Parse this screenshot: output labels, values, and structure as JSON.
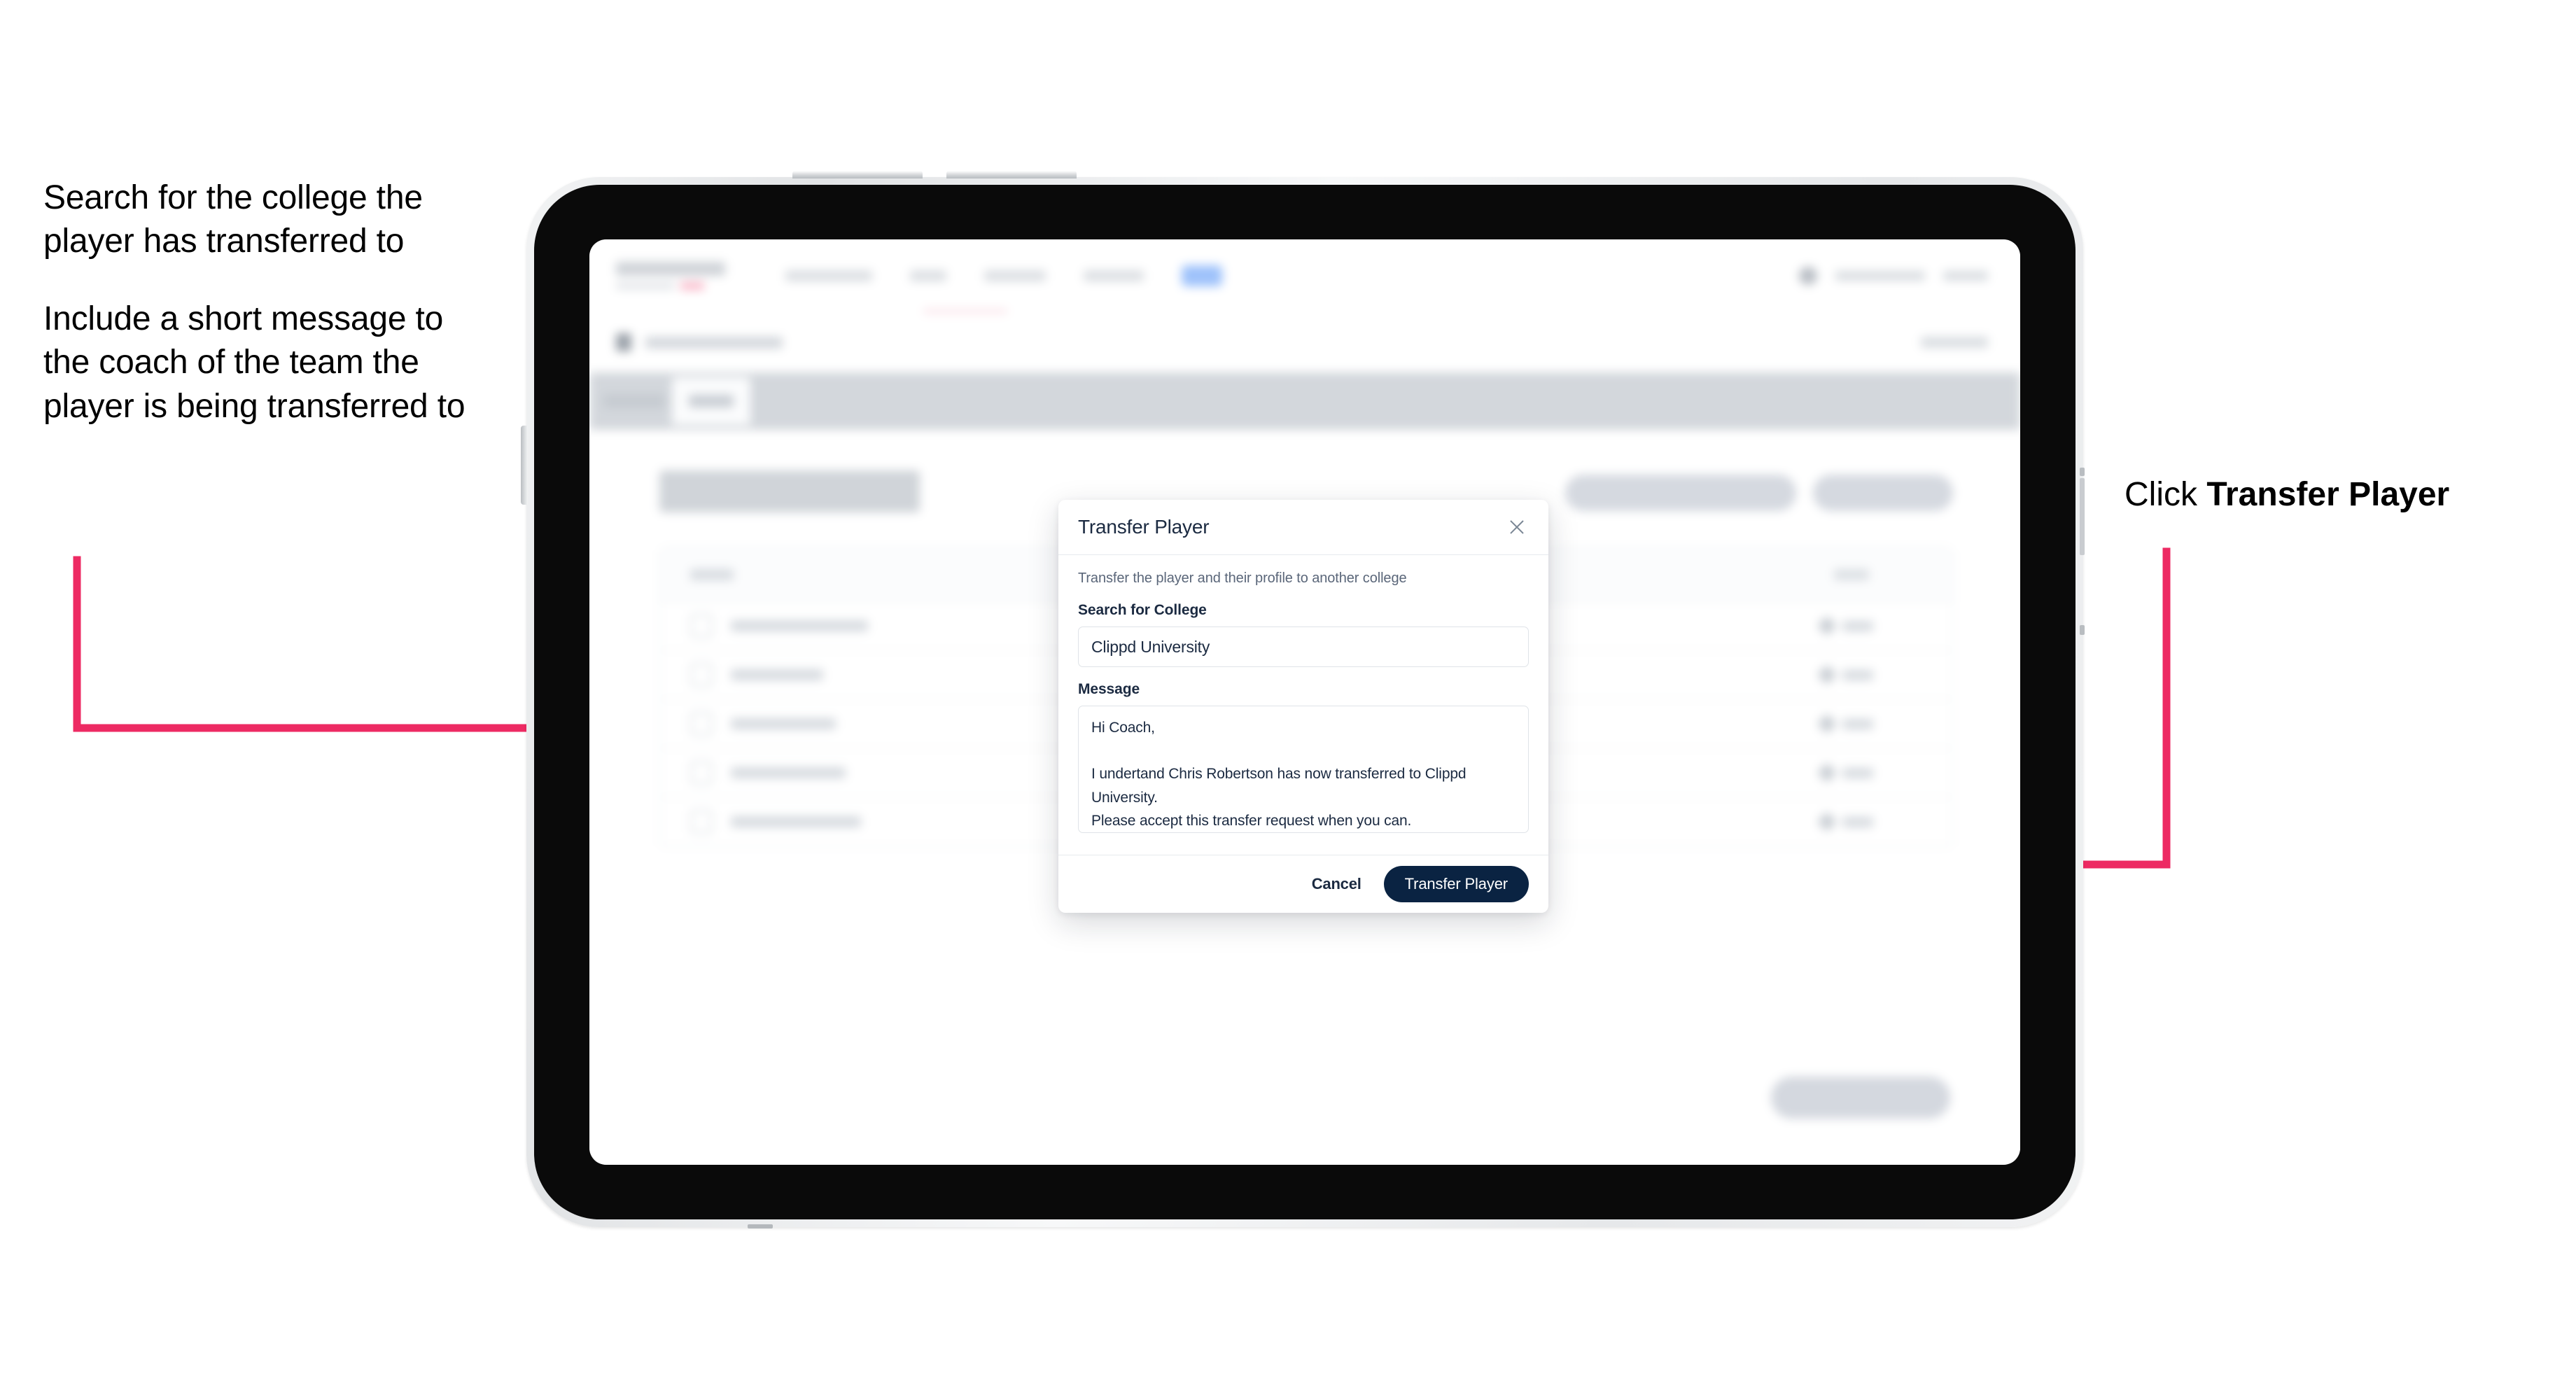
{
  "annotations": {
    "left": [
      "Search for the college the player has transferred to",
      "Include a short message to the coach of the team the player is being transferred to"
    ],
    "right_prefix": "Click ",
    "right_bold": "Transfer Player"
  },
  "modal": {
    "title": "Transfer Player",
    "close_icon": "close-icon",
    "subtitle": "Transfer the player and their profile to another college",
    "college_label": "Search for College",
    "college_value": "Clippd University",
    "college_placeholder": "Search for College",
    "message_label": "Message",
    "message_value": "Hi Coach,\n\nI undertand Chris Robertson has now transferred to Clippd University.\nPlease accept this transfer request when you can.",
    "message_placeholder": "Message",
    "cancel_label": "Cancel",
    "submit_label": "Transfer Player"
  },
  "colors": {
    "annotation_arrow": "#ED2A63",
    "primary_button": "#0A2342",
    "modal_title_text": "#1B2A41",
    "device_bezel": "#0A0A0A",
    "device_body": "#E9EBED"
  }
}
